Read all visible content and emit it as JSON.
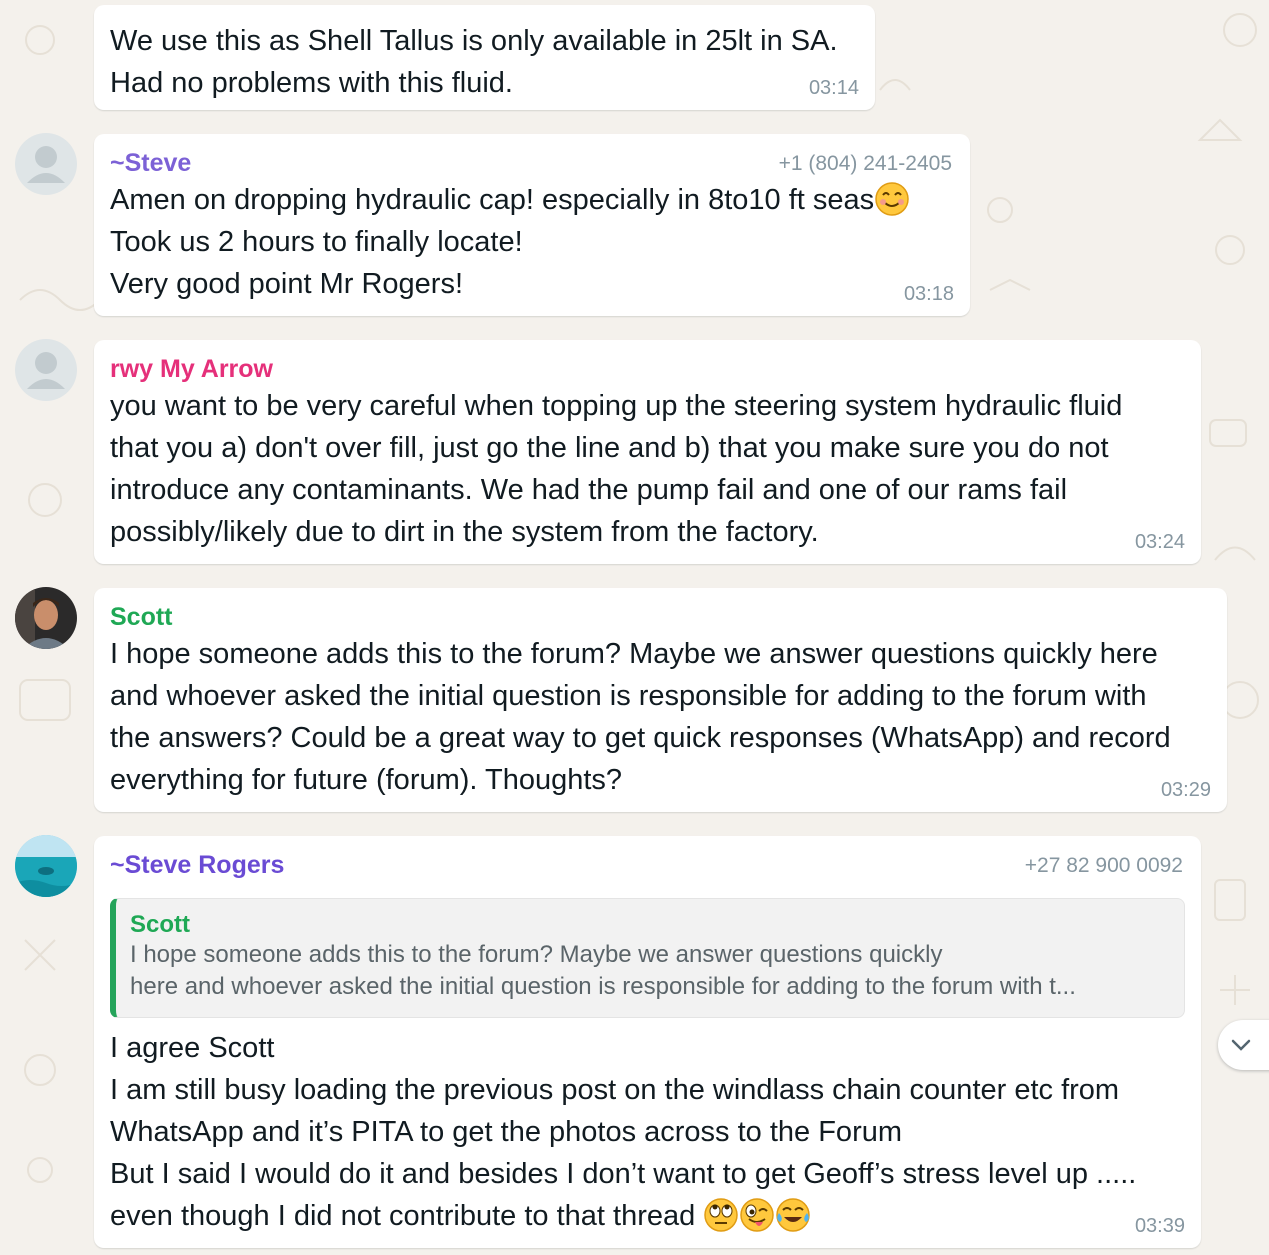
{
  "colors": {
    "steve_name": "#7c61d6",
    "rwy_name": "#e5307a",
    "scott_name": "#1fa855",
    "steve_rogers_name": "#6a4bd4",
    "quote_bar": "#25a45b",
    "timestamp": "#8696a0"
  },
  "messages": [
    {
      "lines": [
        "We use this as Shell Tallus is only available in 25lt in SA.",
        "Had no problems with this fluid."
      ],
      "time": "03:14"
    },
    {
      "sender": "~Steve",
      "phone": "+1 (804) 241-2405",
      "lines": [
        "Amen on dropping hydraulic cap! especially in 8to10 ft seas",
        "Took us 2 hours to finally locate!",
        "Very good point Mr Rogers!"
      ],
      "emoji": "smiling-face-emoji",
      "time": "03:18"
    },
    {
      "sender": "rwy My Arrow",
      "lines": [
        "you want to be very careful when topping up the steering system hydraulic fluid",
        "that you a) don't over fill, just go the line and b) that you make sure you do not",
        "introduce any contaminants.  We had the pump fail and one of our rams fail",
        "possibly/likely due to dirt in the system from the factory."
      ],
      "time": "03:24"
    },
    {
      "sender": "Scott",
      "lines": [
        "I hope someone adds this to the forum? Maybe we answer questions quickly here",
        "and whoever asked the initial question is responsible for adding to the forum with",
        "the answers? Could be a great way to get quick responses (WhatsApp) and record",
        "everything for future (forum). Thoughts?"
      ],
      "time": "03:29"
    },
    {
      "sender": "~Steve Rogers",
      "phone": "+27 82 900 0092",
      "quote": {
        "sender": "Scott",
        "lines": [
          "I hope someone adds this to the forum? Maybe we answer questions quickly",
          "here and whoever asked the initial question is responsible for adding to the forum with t..."
        ]
      },
      "lines": [
        "I agree Scott",
        "I am still busy loading the previous post on the windlass chain counter etc from",
        "WhatsApp and it’s PITA to get the photos across to the Forum",
        "But I said I would do it and besides I don’t want to get Geoff’s stress level up .....",
        "even though I did not contribute to that thread"
      ],
      "emojis": [
        "eye-roll-emoji",
        "winking-tongue-emoji",
        "tears-of-joy-emoji"
      ],
      "time": "03:39"
    }
  ],
  "scroll_button": {
    "icon": "chevron-down-icon"
  }
}
